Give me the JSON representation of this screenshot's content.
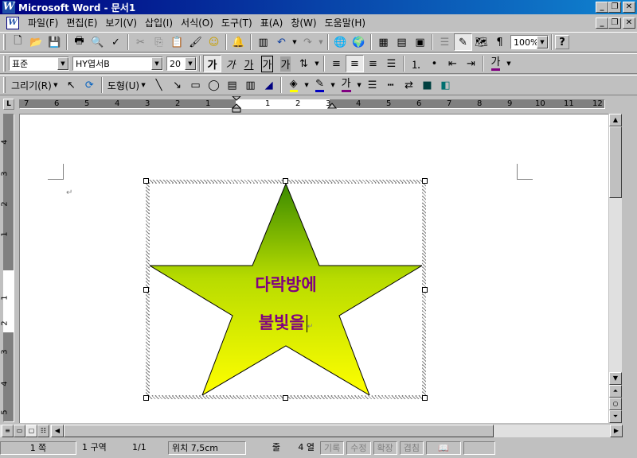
{
  "window": {
    "title": "Microsoft Word - 문서1",
    "app_icon": "W"
  },
  "menu": [
    "파일(F)",
    "편집(E)",
    "보기(V)",
    "삽입(I)",
    "서식(O)",
    "도구(T)",
    "표(A)",
    "창(W)",
    "도움말(H)"
  ],
  "standard_toolbar": {
    "zoom": "100%",
    "help": "?"
  },
  "formatting_toolbar": {
    "style": "표준",
    "font": "HY엽서B",
    "size": "20",
    "bold": "가",
    "italic": "가",
    "underline": "가",
    "char_border": "가",
    "char_shade": "가",
    "font_color": "가"
  },
  "drawing_toolbar": {
    "draw": "그리기(R)",
    "autoshapes": "도형(U)",
    "font_color": "가"
  },
  "ruler": {
    "left_numbers": [
      "7",
      "6",
      "5",
      "4",
      "3",
      "2",
      "1"
    ],
    "center_numbers": [
      "1",
      "2",
      "3"
    ],
    "right_numbers": [
      "4",
      "5",
      "6",
      "7",
      "8",
      "9",
      "10",
      "11",
      "12"
    ],
    "corner": "L"
  },
  "vertical_ruler": [
    "4",
    "3",
    "2",
    "1",
    "1",
    "2",
    "3",
    "4",
    "5"
  ],
  "shape": {
    "line1": "다락방에",
    "line2": "불빛을",
    "fill_top": "#3a8a00",
    "fill_mid": "#b8dc00",
    "fill_bottom": "#ffff00",
    "text_color": "#800080"
  },
  "status": {
    "page": "1 쪽",
    "section": "1 구역",
    "pages": "1/1",
    "position": "위치 7,5cm",
    "line": "줄",
    "column": "4 열",
    "rec": "기록",
    "trk": "수정",
    "ext": "확장",
    "ovr": "겹침"
  }
}
